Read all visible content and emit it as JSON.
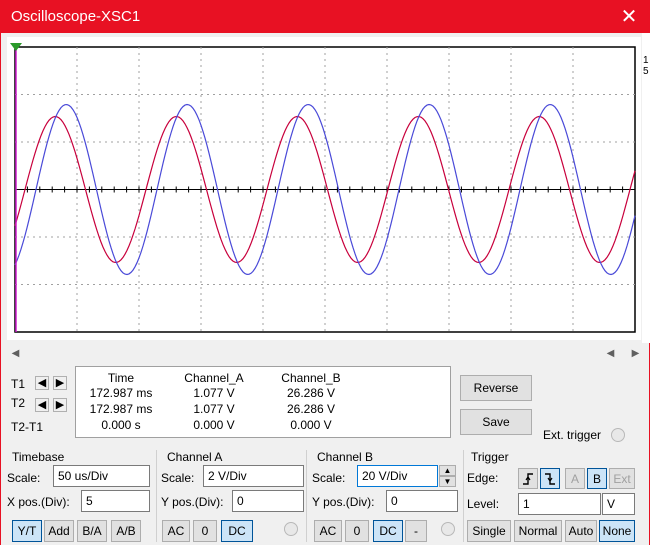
{
  "window": {
    "title": "Oscilloscope-XSC1",
    "close_glyph": "✕"
  },
  "right_strip_text": [
    "1",
    "5"
  ],
  "measurements": {
    "headers": {
      "time": "Time",
      "channel_a": "Channel_A",
      "channel_b": "Channel_B"
    },
    "rows": [
      {
        "label": "T1",
        "time": "172.987 ms",
        "a": "1.077 V",
        "b": "26.286 V"
      },
      {
        "label": "T2",
        "time": "172.987 ms",
        "a": "1.077 V",
        "b": "26.286 V"
      },
      {
        "label": "T2-T1",
        "time": "0.000 s",
        "a": "0.000 V",
        "b": "0.000 V"
      }
    ],
    "reverse_label": "Reverse",
    "save_label": "Save",
    "ext_trigger_label": "Ext. trigger"
  },
  "timebase": {
    "title": "Timebase",
    "scale_label": "Scale:",
    "scale_value": "50 us/Div",
    "xpos_label": "X pos.(Div):",
    "xpos_value": "5",
    "buttons": [
      "Y/T",
      "Add",
      "B/A",
      "A/B"
    ],
    "selected": "Y/T"
  },
  "channel_a": {
    "title": "Channel A",
    "scale_label": "Scale:",
    "scale_value": "2  V/Div",
    "ypos_label": "Y pos.(Div):",
    "ypos_value": "0",
    "buttons": [
      "AC",
      "0",
      "DC"
    ],
    "selected": "DC"
  },
  "channel_b": {
    "title": "Channel B",
    "scale_label": "Scale:",
    "scale_value": "20  V/Div",
    "ypos_label": "Y pos.(Div):",
    "ypos_value": "0",
    "buttons": [
      "AC",
      "0",
      "DC",
      "-"
    ],
    "selected": "DC"
  },
  "trigger": {
    "title": "Trigger",
    "edge_label": "Edge:",
    "edge_buttons": [
      "rising-edge-icon",
      "falling-edge-icon",
      "A",
      "B",
      "Ext"
    ],
    "level_label": "Level:",
    "level_value": "1",
    "level_unit": "V",
    "mode_buttons": [
      "Single",
      "Normal",
      "Auto",
      "None"
    ],
    "selected_mode": "None"
  },
  "traces": {
    "channel_a_color": "#c8003c",
    "channel_b_color": "#4a4ad8",
    "cursor_color": "#d020d0",
    "grid_color": "#a0a0a0"
  }
}
